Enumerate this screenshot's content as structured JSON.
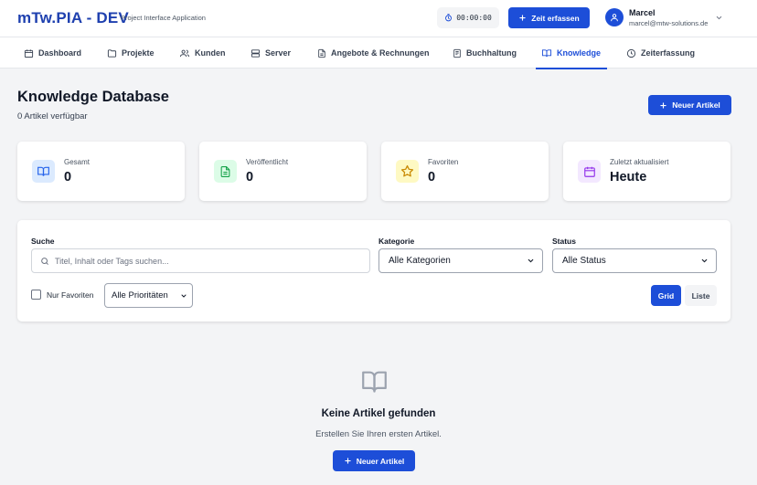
{
  "header": {
    "title": "mTw.PIA - DEV",
    "subtitle": "Project Interface Application",
    "timer": "00:00:00",
    "timer_icon": "stopwatch-icon",
    "time_button": "Zeit erfassen",
    "user": {
      "name": "Marcel",
      "email": "marcel@mtw-solutions.de"
    }
  },
  "nav": {
    "items": [
      {
        "label": "Dashboard",
        "icon": "calendar-icon"
      },
      {
        "label": "Projekte",
        "icon": "folder-icon"
      },
      {
        "label": "Kunden",
        "icon": "users-icon"
      },
      {
        "label": "Server",
        "icon": "server-icon"
      },
      {
        "label": "Angebote & Rechnungen",
        "icon": "file-text-icon"
      },
      {
        "label": "Buchhaltung",
        "icon": "ledger-icon"
      },
      {
        "label": "Knowledge",
        "icon": "book-open-icon",
        "active": true
      },
      {
        "label": "Zeiterfassung",
        "icon": "clock-icon"
      }
    ]
  },
  "page": {
    "title": "Knowledge Database",
    "subtitle": "0 Artikel verfügbar",
    "new_button": "Neuer Artikel"
  },
  "stats": [
    {
      "label": "Gesamt",
      "value": "0",
      "icon": "book-open-icon",
      "color": "#2563eb",
      "bg": "#dbeafe"
    },
    {
      "label": "Veröffentlicht",
      "value": "0",
      "icon": "file-check-icon",
      "color": "#16a34a",
      "bg": "#dcfce7"
    },
    {
      "label": "Favoriten",
      "value": "0",
      "icon": "star-icon",
      "color": "#ca8a04",
      "bg": "#fef9c3"
    },
    {
      "label": "Zuletzt aktualisiert",
      "value": "Heute",
      "icon": "calendar-icon",
      "color": "#9333ea",
      "bg": "#f3e8ff"
    }
  ],
  "filters": {
    "search_label": "Suche",
    "search_placeholder": "Titel, Inhalt oder Tags suchen...",
    "search_value": "",
    "category_label": "Kategorie",
    "category_value": "Alle Kategorien",
    "status_label": "Status",
    "status_value": "Alle Status",
    "favorites_label": "Nur Favoriten",
    "favorites_checked": false,
    "priority_value": "Alle Prioritäten",
    "view_grid": "Grid",
    "view_list": "Liste",
    "active_view": "Grid"
  },
  "empty": {
    "title": "Keine Artikel gefunden",
    "subtitle": "Erstellen Sie Ihren ersten Artikel.",
    "button": "Neuer Artikel"
  },
  "colors": {
    "primary": "#1d4ed8",
    "brand": "#1e40af"
  }
}
